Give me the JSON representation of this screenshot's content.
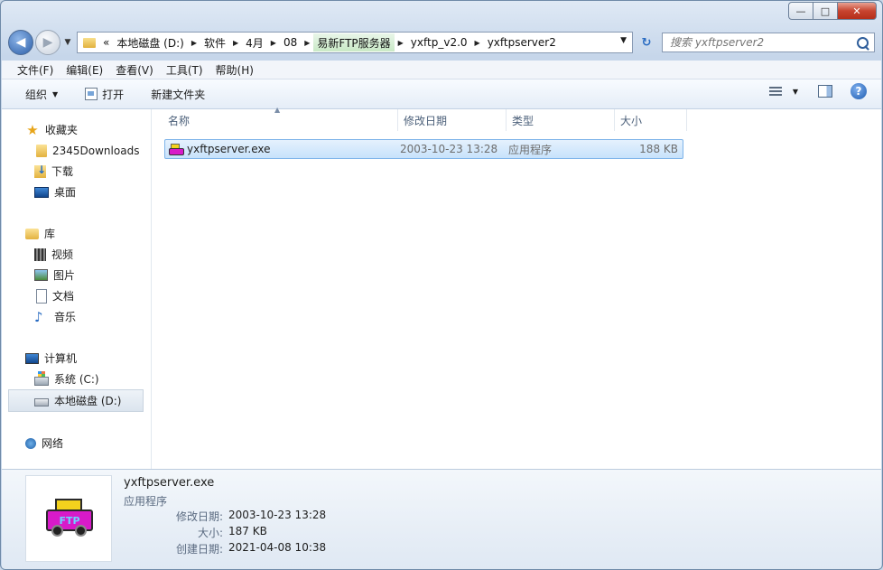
{
  "nav": {
    "breadcrumbs": [
      "本地磁盘 (D:)",
      "软件",
      "4月",
      "08",
      "易新FTP服务器",
      "yxftp_v2.0",
      "yxftpserver2"
    ],
    "overflow": "«",
    "search_placeholder": "搜索 yxftpserver2"
  },
  "menu": [
    "文件(F)",
    "编辑(E)",
    "查看(V)",
    "工具(T)",
    "帮助(H)"
  ],
  "toolbar": {
    "organize": "组织",
    "open": "打开",
    "new_folder": "新建文件夹"
  },
  "sidebar": {
    "favorites": {
      "label": "收藏夹",
      "items": [
        "2345Downloads",
        "下载",
        "桌面"
      ]
    },
    "libraries": {
      "label": "库",
      "items": [
        "视频",
        "图片",
        "文档",
        "音乐"
      ]
    },
    "computer": {
      "label": "计算机",
      "items": [
        "系统 (C:)",
        "本地磁盘 (D:)"
      ]
    },
    "network": {
      "label": "网络"
    }
  },
  "columns": [
    "名称",
    "修改日期",
    "类型",
    "大小"
  ],
  "files": [
    {
      "name": "yxftpserver.exe",
      "modified": "2003-10-23 13:28",
      "type": "应用程序",
      "size": "188 KB"
    }
  ],
  "details": {
    "name": "yxftpserver.exe",
    "type": "应用程序",
    "thumb_text": "FTP",
    "rows": [
      {
        "label": "修改日期:",
        "value": "2003-10-23 13:28"
      },
      {
        "label": "大小:",
        "value": "187 KB"
      },
      {
        "label": "创建日期:",
        "value": "2021-04-08 10:38"
      }
    ]
  },
  "window_controls": {
    "minimize": "—",
    "maximize": "□",
    "close": "✕"
  },
  "colors": {
    "selection": "#cce4fb",
    "accent": "#2a6cc2"
  }
}
